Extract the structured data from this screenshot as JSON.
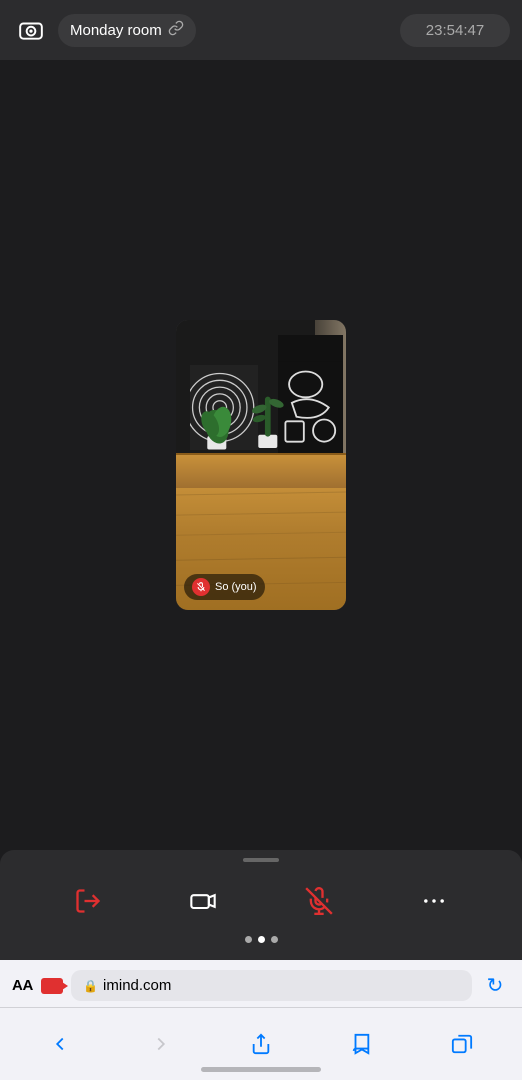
{
  "header": {
    "room_name": "Monday room",
    "timer": "23:54:47"
  },
  "participant": {
    "name": "So  (you)"
  },
  "controls": [
    {
      "id": "leave",
      "label": "Leave",
      "icon": "exit"
    },
    {
      "id": "camera",
      "label": "Camera",
      "icon": "camera"
    },
    {
      "id": "mute",
      "label": "Mute",
      "icon": "mic-off"
    },
    {
      "id": "more",
      "label": "More",
      "icon": "more"
    }
  ],
  "browser": {
    "aa_label": "AA",
    "url": "imind.com"
  },
  "page_dots": [
    false,
    true,
    false
  ]
}
